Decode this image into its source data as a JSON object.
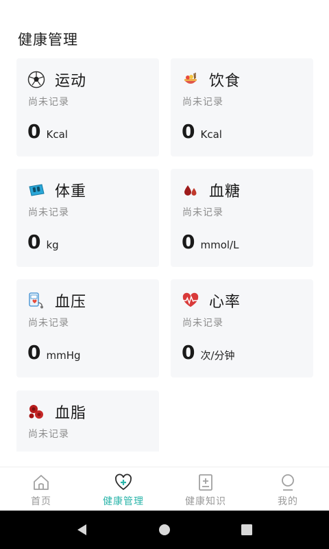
{
  "page": {
    "title": "健康管理"
  },
  "cards": [
    {
      "title": "运动",
      "status": "尚未记录",
      "value": "0",
      "unit": "Kcal",
      "icon": "soccer-ball-icon"
    },
    {
      "title": "饮食",
      "status": "尚未记录",
      "value": "0",
      "unit": "Kcal",
      "icon": "food-icon"
    },
    {
      "title": "体重",
      "status": "尚未记录",
      "value": "0",
      "unit": "kg",
      "icon": "scale-icon"
    },
    {
      "title": "血糖",
      "status": "尚未记录",
      "value": "0",
      "unit": "mmol/L",
      "icon": "blood-drop-icon"
    },
    {
      "title": "血压",
      "status": "尚未记录",
      "value": "0",
      "unit": "mmHg",
      "icon": "blood-pressure-icon"
    },
    {
      "title": "心率",
      "status": "尚未记录",
      "value": "0",
      "unit": "次/分钟",
      "icon": "heartbeat-icon"
    },
    {
      "title": "血脂",
      "status": "尚未记录",
      "icon": "blood-cells-icon"
    }
  ],
  "tabs": [
    {
      "label": "首页",
      "icon": "home-icon",
      "active": false
    },
    {
      "label": "健康管理",
      "icon": "heart-plus-icon",
      "active": true
    },
    {
      "label": "健康知识",
      "icon": "knowledge-doc-icon",
      "active": false
    },
    {
      "label": "我的",
      "icon": "profile-icon",
      "active": false
    }
  ],
  "colors": {
    "accent": "#2bb5aa",
    "card_bg": "#f6f7f9",
    "muted": "#8c8c8c"
  }
}
